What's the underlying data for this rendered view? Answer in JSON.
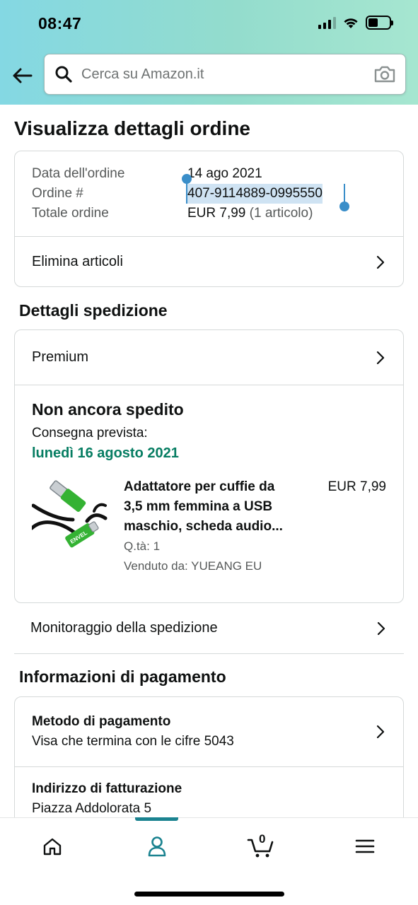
{
  "status_bar": {
    "time": "08:47"
  },
  "search": {
    "placeholder": "Cerca su Amazon.it"
  },
  "page": {
    "title": "Visualizza dettagli ordine"
  },
  "order_summary": {
    "rows": [
      {
        "label": "Data dell'ordine",
        "value": "14 ago 2021"
      },
      {
        "label": "Ordine #",
        "value": "407-9114889-0995550"
      },
      {
        "label": "Totale ordine",
        "value": "EUR 7,99",
        "extra": "(1 articolo)"
      }
    ],
    "delete_items_label": "Elimina articoli"
  },
  "shipping": {
    "section_title": "Dettagli spedizione",
    "service": "Premium",
    "status": "Non ancora spedito",
    "delivery_label": "Consegna prevista:",
    "delivery_date": "lunedì 16 agosto 2021",
    "item": {
      "title_line1": "Adattatore per cuffie da",
      "title_line2": "3,5 mm femmina a USB",
      "title_line3": "maschio, scheda audio...",
      "price": "EUR 7,99",
      "quantity": "Q.tà: 1",
      "seller": "Venduto da: YUEANG EU",
      "image_brand_text": "ENVEL"
    },
    "tracking_label": "Monitoraggio della spedizione"
  },
  "payment": {
    "section_title": "Informazioni di pagamento",
    "method_title": "Metodo di pagamento",
    "method_value": "Visa che termina con le cifre 5043",
    "billing_title": "Indirizzo di fatturazione",
    "billing_value": "Piazza Addolorata 5"
  },
  "tabbar": {
    "cart_count": "0",
    "active_tab": "account"
  },
  "colors": {
    "delivery_green": "#067d62",
    "accent_teal": "#1b8390",
    "selection_blue": "#3a8ec9"
  }
}
